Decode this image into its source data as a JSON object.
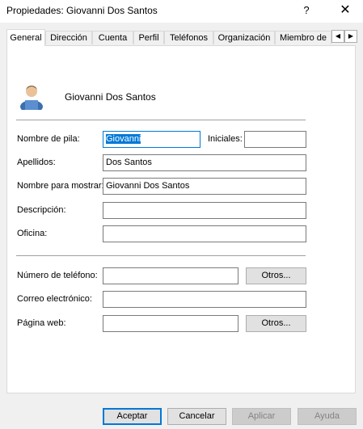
{
  "window": {
    "title": "Propiedades: Giovanni Dos Santos",
    "help_label": "?",
    "close_label": "✕"
  },
  "tabs": [
    {
      "label": "General",
      "active": true
    },
    {
      "label": "Dirección"
    },
    {
      "label": "Cuenta"
    },
    {
      "label": "Perfil"
    },
    {
      "label": "Teléfonos"
    },
    {
      "label": "Organización"
    },
    {
      "label": "Miembro de"
    }
  ],
  "tab_scroll": {
    "left": "◀",
    "right": "▶"
  },
  "user": {
    "avatar_icon": "user-icon",
    "display_name": "Giovanni Dos Santos"
  },
  "form": {
    "first_name_label": "Nombre de pila:",
    "first_name_value": "Giovanni",
    "initials_label": "Iniciales:",
    "initials_value": "",
    "last_name_label": "Apellidos:",
    "last_name_value": "Dos Santos",
    "display_name_label": "Nombre para mostrar:",
    "display_name_value": "Giovanni Dos Santos",
    "description_label": "Descripción:",
    "description_value": "",
    "office_label": "Oficina:",
    "office_value": "",
    "phone_label": "Número de teléfono:",
    "phone_value": "",
    "phone_other_label": "Otros...",
    "email_label": "Correo electrónico:",
    "email_value": "",
    "web_label": "Página web:",
    "web_value": "",
    "web_other_label": "Otros..."
  },
  "footer": {
    "ok_label": "Aceptar",
    "cancel_label": "Cancelar",
    "apply_label": "Aplicar",
    "help_label": "Ayuda"
  },
  "colors": {
    "accent": "#0078d7",
    "dialog_bg": "#f0f0f0"
  }
}
